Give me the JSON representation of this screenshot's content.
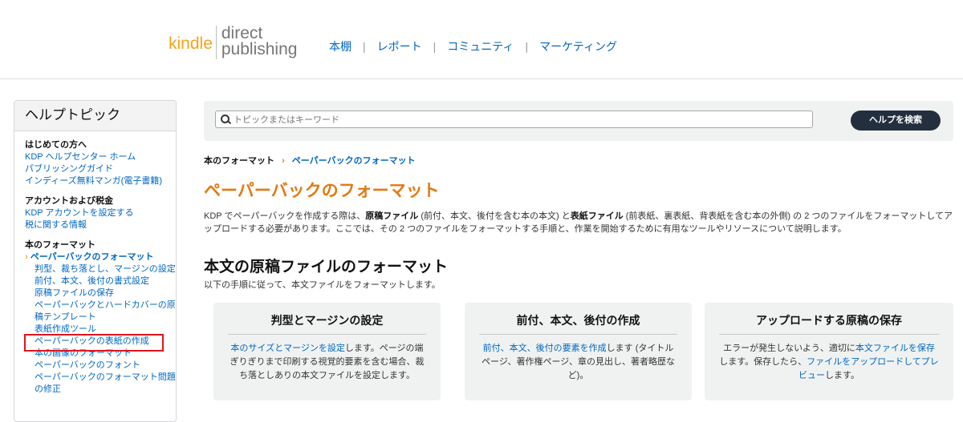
{
  "header": {
    "logo_kindle": "kindle",
    "logo_direct": "direct",
    "logo_publishing": "publishing",
    "nav": [
      "本棚",
      "レポート",
      "コミュニティ",
      "マーケティング"
    ],
    "nav_separator": "|"
  },
  "sidebar": {
    "title": "ヘルプトピック",
    "groups": [
      {
        "title": "はじめての方へ",
        "items": [
          "KDP ヘルプセンター ホーム",
          "パブリッシングガイド",
          "インディーズ無料マンガ(電子書籍)"
        ]
      },
      {
        "title": "アカウントおよび税金",
        "items": [
          "KDP アカウントを設定する",
          "税に関する情報"
        ]
      },
      {
        "title": "本のフォーマット",
        "active_item": "ペーパーバックのフォーマット",
        "sub_items": [
          "判型、裁ち落とし、マージンの設定",
          "前付、本文、後付の書式設定",
          "原稿ファイルの保存",
          "ペーパーバックとハードカバーの原稿テンプレート",
          "表紙作成ツール",
          "ペーパーバックの表紙の作成",
          "本の画像のフォーマット",
          "ペーパーバックのフォント",
          "ペーパーバックのフォーマット問題の修正"
        ]
      }
    ]
  },
  "search": {
    "placeholder": "トピックまたはキーワード",
    "button_label": "ヘルプを検索"
  },
  "breadcrumb": {
    "root": "本のフォーマット",
    "separator": "›",
    "current": "ペーパーバックのフォーマット"
  },
  "main": {
    "title": "ペーパーバックのフォーマット",
    "intro_1": "KDP でペーパーバックを作成する際は、",
    "intro_b1": "原稿ファイル",
    "intro_2": " (前付、本文、後付を含む本の本文) と",
    "intro_b2": "表紙ファイル",
    "intro_3": " (前表紙、裏表紙、背表紙を含む本の外側) の 2 つのファイルをフォーマットしてアップロードする必要があります。ここでは、その 2 つのファイルをフォーマットする手順と、作業を開始するために有用なツールやリソースについて説明します。",
    "section_title": "本文の原稿ファイルのフォーマット",
    "section_sub": "以下の手順に従って、本文ファイルをフォーマットします。",
    "cards": [
      {
        "title": "判型とマージンの設定",
        "link": "本のサイズとマージンを設定",
        "text": "します。ページの端ぎりぎりまで印刷する視覚的要素を含む場合、裁ち落としありの本文ファイルを設定します。"
      },
      {
        "title": "前付、本文、後付の作成",
        "link": "前付、本文、後付の要素を作成",
        "text": "します (タイトル ページ、著作権ページ、章の見出し、著者略歴など)。"
      },
      {
        "title": "アップロードする原稿の保存",
        "text_before": "エラーが発生しないよう、適切に",
        "link": "本文ファイルを保存",
        "text_mid": "します。保存したら、",
        "link2": "ファイルをアップロードしてプレビュー",
        "text_after": "します。"
      }
    ]
  }
}
